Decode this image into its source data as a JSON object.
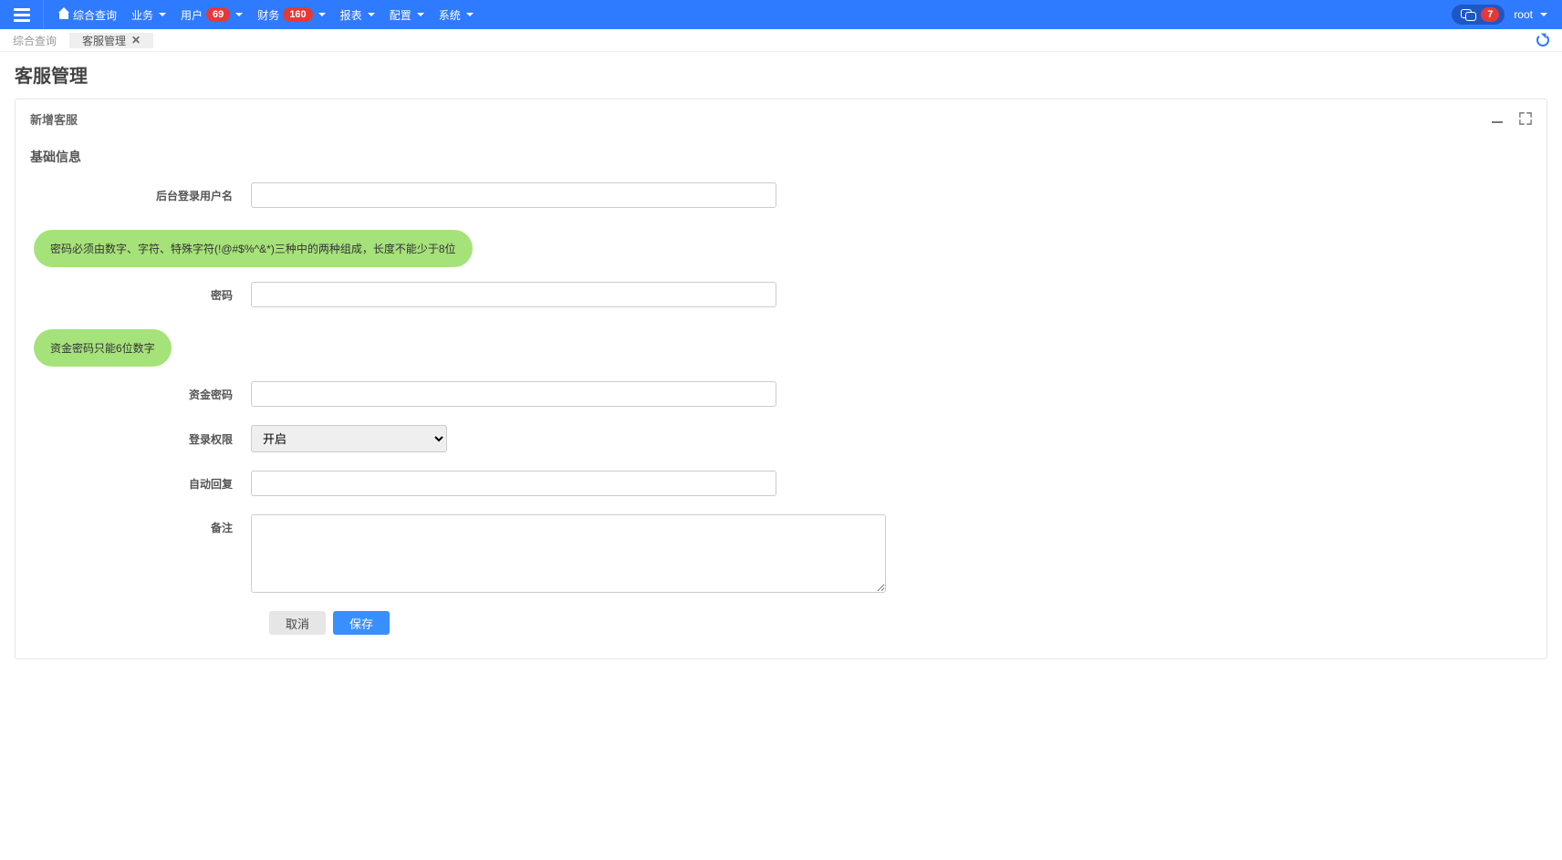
{
  "nav": {
    "home": "综合查询",
    "items": [
      {
        "label": "业务",
        "badge": null
      },
      {
        "label": "用户",
        "badge": "69"
      },
      {
        "label": "财务",
        "badge": "160"
      },
      {
        "label": "报表",
        "badge": null
      },
      {
        "label": "配置",
        "badge": null
      },
      {
        "label": "系统",
        "badge": null
      }
    ],
    "chat_badge": "7",
    "user": "root"
  },
  "tabs": {
    "inactive": "综合查询",
    "active": "客服管理"
  },
  "page_title": "客服管理",
  "panel": {
    "title": "新增客服",
    "section": "基础信息",
    "hints": {
      "password": "密码必须由数字、字符、特殊字符(!@#$%^&*)三种中的两种组成，长度不能少于8位",
      "fund": "资金密码只能6位数字"
    },
    "fields": {
      "username_label": "后台登录用户名",
      "password_label": "密码",
      "fund_label": "资金密码",
      "login_perm_label": "登录权限",
      "login_perm_selected": "开启",
      "login_perm_options": [
        "开启"
      ],
      "auto_reply_label": "自动回复",
      "remark_label": "备注"
    },
    "buttons": {
      "cancel": "取消",
      "save": "保存"
    }
  }
}
